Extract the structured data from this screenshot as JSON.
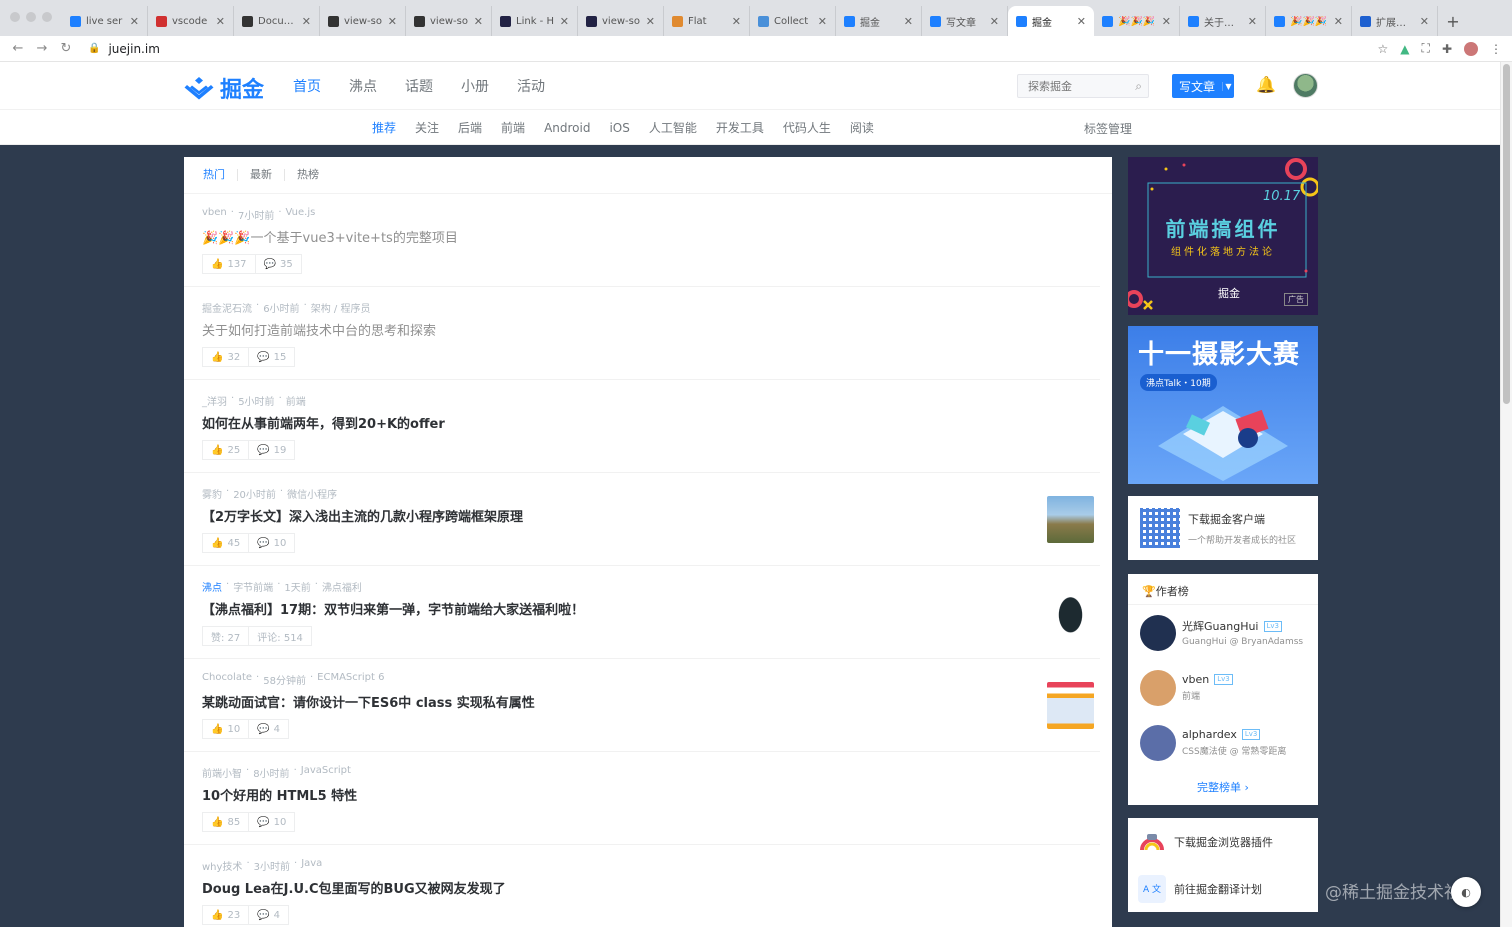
{
  "browser": {
    "tabs": [
      {
        "label": "live ser",
        "color": "#1e80ff"
      },
      {
        "label": "vscode",
        "color": "#d03030"
      },
      {
        "label": "Docume",
        "color": "#333333"
      },
      {
        "label": "view-so",
        "color": "#333333"
      },
      {
        "label": "view-so",
        "color": "#333333"
      },
      {
        "label": "Link - H",
        "color": "#222244"
      },
      {
        "label": "view-so",
        "color": "#222244"
      },
      {
        "label": "Flat",
        "color": "#e08a30"
      },
      {
        "label": "Collect",
        "color": "#4a90d9"
      },
      {
        "label": "掘金",
        "color": "#1e80ff"
      },
      {
        "label": "写文章",
        "color": "#1e80ff"
      },
      {
        "label": "掘金",
        "color": "#1e80ff",
        "active": true
      },
      {
        "label": "🎉🎉🎉",
        "color": "#1e80ff"
      },
      {
        "label": "关于如何",
        "color": "#1e80ff"
      },
      {
        "label": "🎉🎉🎉",
        "color": "#1e80ff"
      },
      {
        "label": "扩展程序",
        "color": "#1e60d0"
      }
    ],
    "url": "juejin.im"
  },
  "header": {
    "logo": "掘金",
    "nav": [
      "首页",
      "沸点",
      "话题",
      "小册",
      "活动"
    ],
    "search_placeholder": "探索掘金",
    "write_label": "写文章"
  },
  "subnav": {
    "items": [
      "推荐",
      "关注",
      "后端",
      "前端",
      "Android",
      "iOS",
      "人工智能",
      "开发工具",
      "代码人生",
      "阅读"
    ],
    "tag_manage": "标签管理"
  },
  "feed": {
    "tabs": [
      "热门",
      "最新",
      "热榜"
    ],
    "articles": [
      {
        "author": "vben",
        "time": "7小时前",
        "tags": "Vue.js",
        "title": "🎉🎉🎉一个基于vue3+vite+ts的完整项目",
        "likes": "137",
        "comments": "35",
        "read": true
      },
      {
        "author": "掘金泥石流",
        "time": "6小时前",
        "tags": "架构 / 程序员",
        "title": "关于如何打造前端技术中台的思考和探索",
        "likes": "32",
        "comments": "15",
        "read": true
      },
      {
        "author": "_洋羽",
        "time": "5小时前",
        "tags": "前端",
        "title": "如何在从事前端两年，得到20+K的offer",
        "likes": "25",
        "comments": "19"
      },
      {
        "author": "雾豹",
        "time": "20小时前",
        "tags": "微信小程序",
        "title": "【2万字长文】深入浅出主流的几款小程序跨端框架原理",
        "likes": "45",
        "comments": "10",
        "thumb": "mountain"
      },
      {
        "author": "沸点",
        "time": "1天前",
        "byline": "字节前端",
        "tags": "沸点福利",
        "title": "【沸点福利】17期：双节归来第一弹，字节前端给大家送福利啦！",
        "likes": "赞: 27",
        "comments": "评论: 514",
        "hot": true,
        "thumb": "bag"
      },
      {
        "author": "Chocolate",
        "time": "58分钟前",
        "tags": "ECMAScript 6",
        "title": "某跳动面试官：请你设计一下ES6中 class 实现私有属性",
        "likes": "10",
        "comments": "4",
        "thumb": "doc"
      },
      {
        "author": "前端小智",
        "time": "8小时前",
        "tags": "JavaScript",
        "title": "10个好用的 HTML5 特性",
        "likes": "85",
        "comments": "10"
      },
      {
        "author": "why技术",
        "time": "3小时前",
        "tags": "Java",
        "title": "Doug Lea在J.U.C包里面写的BUG又被网友发现了",
        "likes": "23",
        "comments": "4"
      }
    ]
  },
  "sidebar": {
    "ad1": {
      "date": "10.17",
      "title": "前端搞组件",
      "subtitle": "组件化落地方法论",
      "brand": "掘金",
      "badge": "广告"
    },
    "ad2": {
      "title": "十一摄影大赛",
      "tag": "沸点Talk・10期"
    },
    "download": {
      "title": "下载掘金客户端",
      "subtitle": "一个帮助开发者成长的社区"
    },
    "authors_title": "🏆作者榜",
    "authors": [
      {
        "name": "光辉GuangHui",
        "desc": "GuangHui @ BryanAdamss",
        "color": "#203050"
      },
      {
        "name": "vben",
        "desc": "前端",
        "color": "#d9a06a"
      },
      {
        "name": "alphardex",
        "desc": "CSS魔法使 @ 常熟零距离",
        "color": "#5b6ea8"
      }
    ],
    "level": "Lv3",
    "full_rank": "完整榜单 ›",
    "links": [
      {
        "label": "下载掘金浏览器插件"
      },
      {
        "label": "前往掘金翻译计划",
        "icon": "A 文"
      }
    ]
  },
  "watermark": "@稀土掘金技术社区"
}
